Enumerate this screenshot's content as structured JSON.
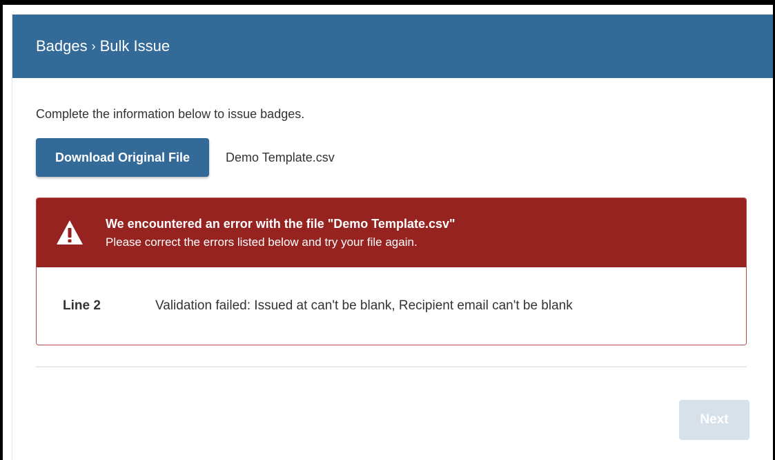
{
  "header": {
    "breadcrumb": {
      "parent": "Badges",
      "separator": "›",
      "current": "Bulk Issue"
    }
  },
  "main": {
    "intro_text": "Complete the information below to issue badges.",
    "download_button_label": "Download Original File",
    "file_name": "Demo Template.csv",
    "error": {
      "icon": "warning-icon",
      "title": "We encountered an error with the file \"Demo Template.csv\"",
      "subtitle": "Please correct the errors listed below and try your file again.",
      "items": [
        {
          "line": "Line 2",
          "message": "Validation failed: Issued at can't be blank, Recipient email can't be blank"
        }
      ]
    },
    "next_button_label": "Next"
  },
  "colors": {
    "header_bg": "#336a98",
    "primary_button": "#336a98",
    "error_header_bg": "#962320",
    "error_border": "#b84848",
    "disabled_button": "#d6e1ea"
  }
}
